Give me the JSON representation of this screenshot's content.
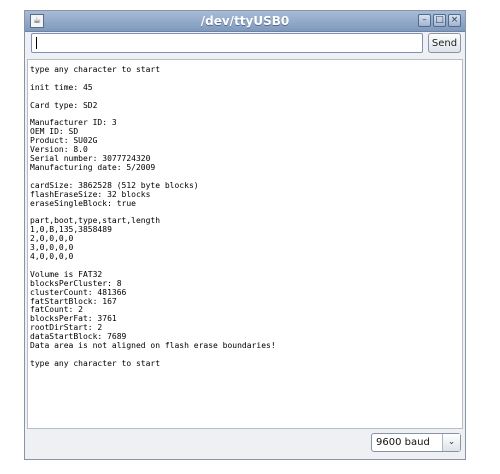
{
  "window": {
    "title": "/dev/ttyUSB0",
    "icon_glyph": "☕",
    "minimize_glyph": "–",
    "maximize_glyph": "□",
    "close_glyph": "×"
  },
  "input": {
    "value": "",
    "placeholder": ""
  },
  "send_button": {
    "label": "Send"
  },
  "output": {
    "text": "type any character to start\n\ninit time: 45\n\nCard type: SD2\n\nManufacturer ID: 3\nOEM ID: SD\nProduct: SU02G\nVersion: 8.0\nSerial number: 3077724320\nManufacturing date: 5/2009\n\ncardSize: 3862528 (512 byte blocks)\nflashEraseSize: 32 blocks\neraseSingleBlock: true\n\npart,boot,type,start,length\n1,0,B,135,3858489\n2,0,0,0,0\n3,0,0,0,0\n4,0,0,0,0\n\nVolume is FAT32\nblocksPerCluster: 8\nclusterCount: 481366\nfatStartBlock: 167\nfatCount: 2\nblocksPerFat: 3761\nrootDirStart: 2\ndataStartBlock: 7689\nData area is not aligned on flash erase boundaries!\n\ntype any character to start"
  },
  "baud": {
    "selected": "9600 baud",
    "arrow_glyph": "⌄"
  },
  "icons": {
    "app": "java-coffee-icon",
    "minimize": "minimize-icon",
    "maximize": "maximize-icon",
    "close": "close-icon",
    "dropdown": "chevron-down-icon"
  }
}
